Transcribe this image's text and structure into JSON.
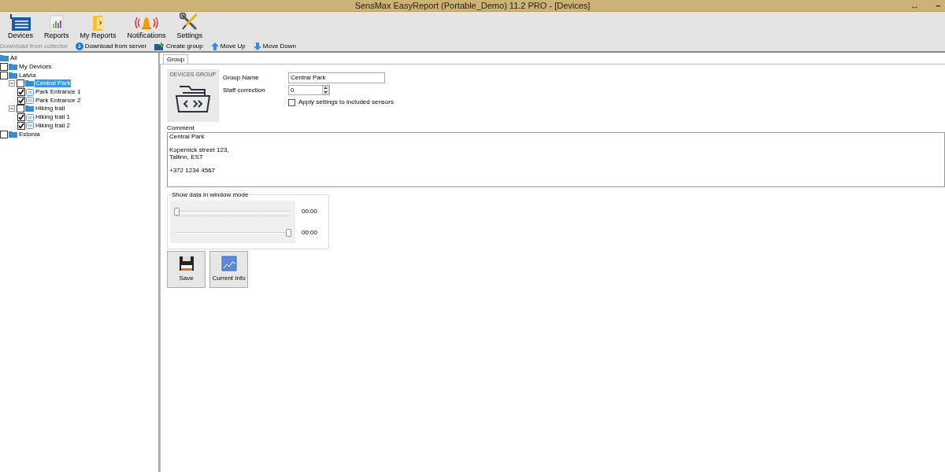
{
  "window": {
    "title": "SensMax EasyReport (Portable_Demo) 11.2 PRO - [Devices]",
    "controls": [
      "↔",
      "‒"
    ]
  },
  "toolbar": [
    {
      "kind": "devices",
      "label": "Devices"
    },
    {
      "kind": "reports",
      "label": "Reports"
    },
    {
      "kind": "myreports",
      "label": "My Reports"
    },
    {
      "kind": "notifications",
      "label": "Notifications"
    },
    {
      "kind": "settings",
      "label": "Settings"
    }
  ],
  "actions": [
    {
      "kind": "none",
      "label": "Download from collector",
      "disabled": true
    },
    {
      "kind": "server",
      "label": "Download from server",
      "disabled": false
    },
    {
      "kind": "group",
      "label": "Create group",
      "disabled": false
    },
    {
      "kind": "up",
      "label": "Move Up",
      "disabled": false
    },
    {
      "kind": "down",
      "label": "Move Down",
      "disabled": false
    }
  ],
  "tree": [
    {
      "label": "All",
      "kind": "folder",
      "selected": false,
      "children": [
        {
          "label": "My Devices",
          "kind": "folder",
          "checked": false,
          "selected": false
        },
        {
          "label": "Latvia",
          "kind": "folder",
          "checked": false,
          "selected": false,
          "children": [
            {
              "label": "Central Park",
              "kind": "folder",
              "checked": false,
              "expanded": true,
              "selected": true,
              "children": [
                {
                  "label": "Park Entrance 1",
                  "kind": "sensor",
                  "checked": true,
                  "selected": false
                },
                {
                  "label": "Park Entrance 2",
                  "kind": "sensor",
                  "checked": true,
                  "selected": false
                }
              ]
            },
            {
              "label": "Hiking trail",
              "kind": "folder",
              "checked": false,
              "expanded": true,
              "selected": false,
              "children": [
                {
                  "label": "Hiking trail 1",
                  "kind": "sensor",
                  "checked": true,
                  "selected": false
                },
                {
                  "label": "Hiking trail 2",
                  "kind": "sensor",
                  "checked": true,
                  "selected": false
                }
              ]
            }
          ]
        },
        {
          "label": "Estonia",
          "kind": "folder",
          "checked": false,
          "selected": false
        }
      ]
    }
  ],
  "tabs": [
    {
      "label": "Group",
      "selected": true
    }
  ],
  "group": {
    "caption": "DEVICES GROUP",
    "name_label": "Group Name",
    "name_value": "Central Park",
    "staff_label": "Staff correction",
    "staff_value": "0",
    "apply_label": "Apply settings to included sensors",
    "apply_checked": false,
    "comment_label": "Comment",
    "comment_paragraphs": [
      [
        "Central Park"
      ],
      [
        "Kopernick street 123,",
        "Tallinn, EST"
      ],
      [
        "+372 1234 4567"
      ]
    ]
  },
  "window_mode": {
    "title": "Show data in window mode",
    "sliders": [
      {
        "level": 0,
        "reading": "00:00"
      },
      {
        "level": 1,
        "reading": "00:00"
      }
    ]
  },
  "buttons": [
    {
      "kind": "save",
      "label": "Save"
    },
    {
      "kind": "info",
      "label": "Current Info"
    }
  ]
}
